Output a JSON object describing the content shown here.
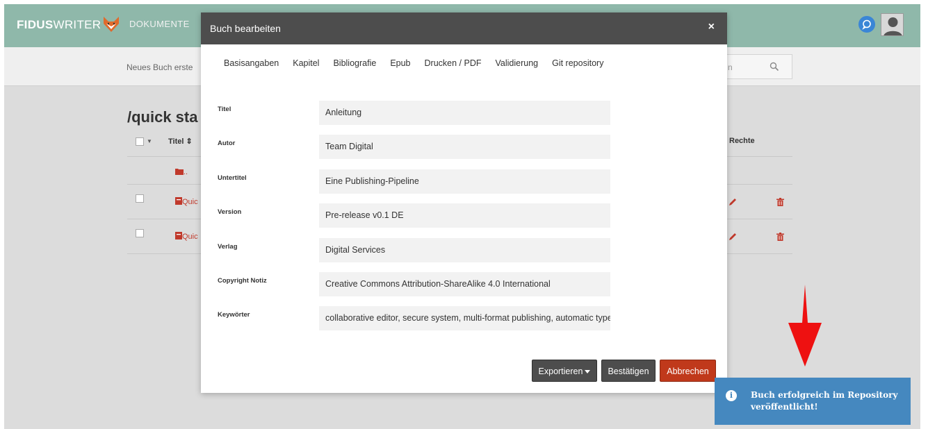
{
  "app": {
    "brand_bold": "FIDUS",
    "brand_light": "WRITER",
    "nav_documents": "DOKUMENTE",
    "new_book": "Neues Buch erste",
    "search_placeholder": "n",
    "folder_title": "/quick sta",
    "table": {
      "col_title": "Titel",
      "col_rights": "Rechte",
      "up_folder": "..",
      "rows": [
        {
          "title": "Quic"
        },
        {
          "title": "Quic"
        }
      ]
    }
  },
  "modal": {
    "title": "Buch bearbeiten",
    "close": "×",
    "tabs": [
      "Basisangaben",
      "Kapitel",
      "Bibliografie",
      "Epub",
      "Drucken / PDF",
      "Validierung",
      "Git repository"
    ],
    "fields": [
      {
        "label": "Titel",
        "value": "Anleitung"
      },
      {
        "label": "Autor",
        "value": "Team Digital"
      },
      {
        "label": "Untertitel",
        "value": "Eine Publishing-Pipeline"
      },
      {
        "label": "Version",
        "value": "Pre-release v0.1 DE"
      },
      {
        "label": "Verlag",
        "value": "Digital Services"
      },
      {
        "label": "Copyright Notiz",
        "value": "Creative Commons Attribution-ShareAlike 4.0 International"
      },
      {
        "label": "Keywörter",
        "value": "collaborative editor, secure system, multi-format publishing, automatic typeset"
      }
    ],
    "buttons": {
      "export": "Exportieren",
      "confirm": "Bestätigen",
      "cancel": "Abbrechen"
    }
  },
  "notification": {
    "icon": "info-icon",
    "text": "Buch erfolgreich im Repository veröffentlicht!"
  },
  "colors": {
    "topbar": "#8fb8aa",
    "modal_header": "#4d4d4d",
    "cancel": "#c0391b",
    "toast": "#4588bf",
    "annotation_arrow": "#ee1111"
  }
}
